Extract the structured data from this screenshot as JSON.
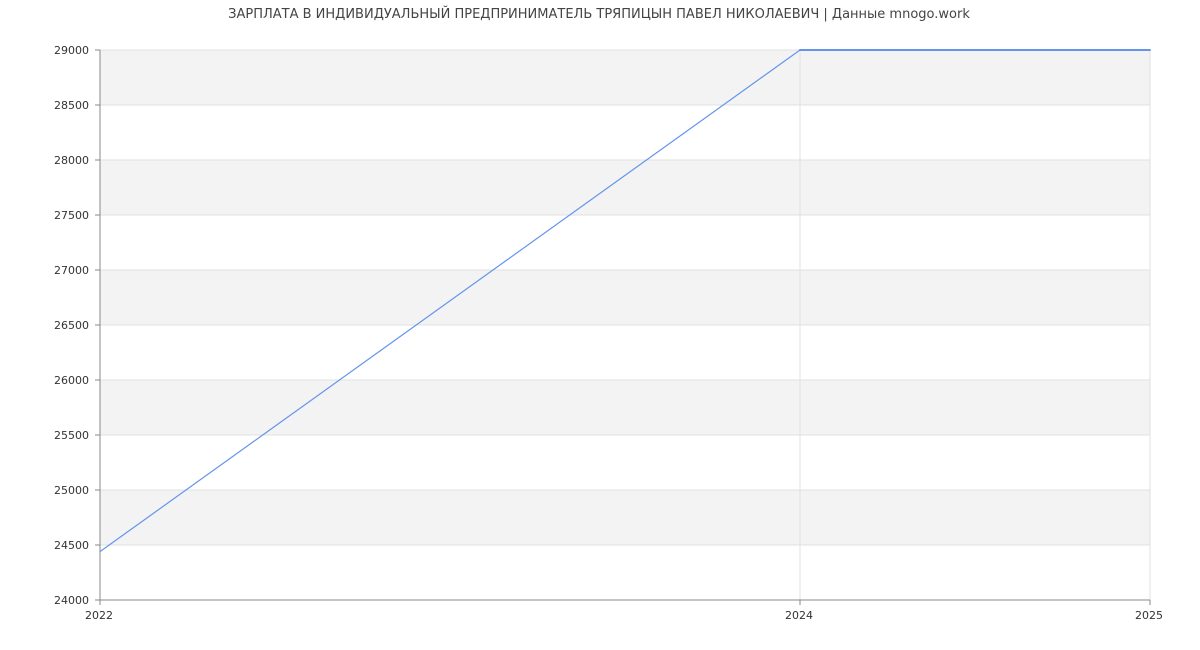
{
  "chart_data": {
    "type": "line",
    "title": "ЗАРПЛАТА В ИНДИВИДУАЛЬНЫЙ ПРЕДПРИНИМАТЕЛЬ ТРЯПИЦЫН ПАВЕЛ НИКОЛАЕВИЧ | Данные mnogo.work",
    "xlabel": "",
    "ylabel": "",
    "x_ticks": [
      "2022",
      "2024",
      "2025"
    ],
    "y_ticks": [
      24000,
      24500,
      25000,
      25500,
      26000,
      26500,
      27000,
      27500,
      28000,
      28500,
      29000
    ],
    "xlim": [
      2022,
      2025
    ],
    "ylim": [
      24000,
      29000
    ],
    "grid": true,
    "legend": "none",
    "series": [
      {
        "color": "#6495ed",
        "points": [
          {
            "x": 2022,
            "y": 24440
          },
          {
            "x": 2024,
            "y": 29000
          },
          {
            "x": 2025,
            "y": 29000
          }
        ]
      }
    ],
    "colors": {
      "band": "#f3f3f3",
      "gridline": "#e0e0e0",
      "axis": "#888888"
    }
  }
}
